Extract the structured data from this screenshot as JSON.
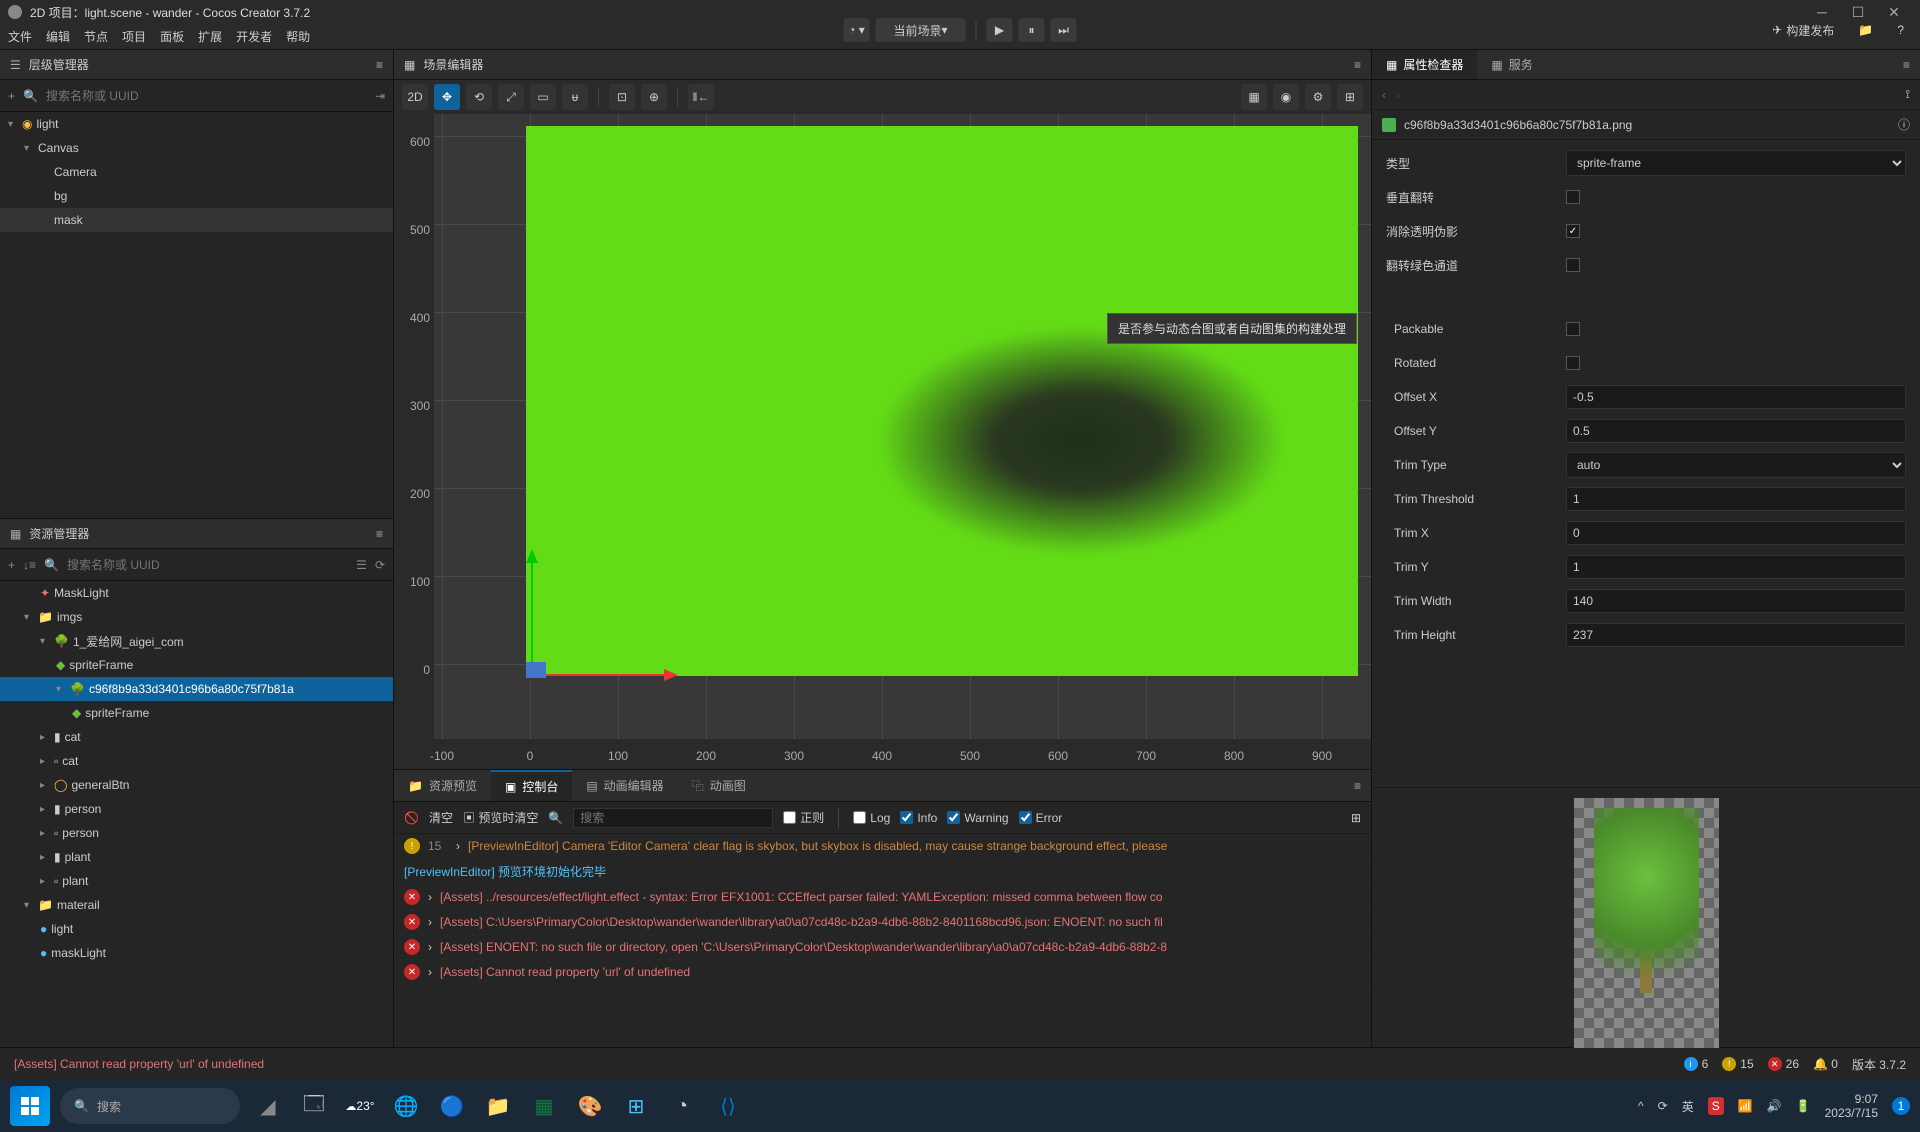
{
  "titlebar": {
    "title": "2D 项目：light.scene - wander - Cocos Creator 3.7.2"
  },
  "menubar": [
    "文件",
    "编辑",
    "节点",
    "项目",
    "面板",
    "扩展",
    "开发者",
    "帮助"
  ],
  "toolbar_center": {
    "scene_label": "当前场景"
  },
  "toolbar_right": {
    "build": "构建发布"
  },
  "hierarchy": {
    "title": "层级管理器",
    "search_placeholder": "搜索名称或 UUID",
    "nodes": [
      "light",
      "Canvas",
      "Camera",
      "bg",
      "mask"
    ]
  },
  "assets": {
    "title": "资源管理器",
    "search_placeholder": "搜索名称或 UUID",
    "items": {
      "masklight": "MaskLight",
      "imgs": "imgs",
      "aigei": "1_爱给网_aigei_com",
      "sf1": "spriteFrame",
      "selected": "c96f8b9a33d3401c96b6a80c75f7b81a",
      "sf2": "spriteFrame",
      "cat1": "cat",
      "cat2": "cat",
      "general": "generalBtn",
      "person1": "person",
      "person2": "person",
      "plant1": "plant",
      "plant2": "plant",
      "material": "materail",
      "light": "light",
      "maskLight": "maskLight"
    }
  },
  "scene": {
    "title": "场景编辑器",
    "mode": "2D",
    "v_ticks": [
      "600",
      "500",
      "400",
      "300",
      "200",
      "100",
      "0"
    ],
    "h_ticks": [
      "-100",
      "0",
      "100",
      "200",
      "300",
      "400",
      "500",
      "600",
      "700",
      "800",
      "900"
    ]
  },
  "tooltip": "是否参与动态合图或者自动图集的构建处理",
  "bottom_tabs": {
    "preview": "资源预览",
    "console": "控制台",
    "anim": "动画编辑器",
    "graph": "动画图"
  },
  "console": {
    "clear": "清空",
    "preview_clear": "预览时清空",
    "search_placeholder": "搜索",
    "regex": "正则",
    "log": "Log",
    "info": "Info",
    "warning": "Warning",
    "error": "Error",
    "rows": [
      {
        "type": "warn",
        "count": "15",
        "msg": "[PreviewInEditor] Camera 'Editor Camera' clear flag is skybox, but skybox is disabled, may cause strange background effect, please"
      },
      {
        "type": "info",
        "msg": "[PreviewInEditor] 预览环境初始化完毕"
      },
      {
        "type": "err",
        "msg": "[Assets] ../resources/effect/light.effect - syntax: Error EFX1001: CCEffect parser failed: YAMLException: missed comma between flow co"
      },
      {
        "type": "err",
        "msg": "[Assets] C:\\Users\\PrimaryColor\\Desktop\\wander\\wander\\library\\a0\\a07cd48c-b2a9-4db6-88b2-8401168bcd96.json: ENOENT: no such fil"
      },
      {
        "type": "err",
        "msg": "[Assets] ENOENT: no such file or directory, open 'C:\\Users\\PrimaryColor\\Desktop\\wander\\wander\\library\\a0\\a07cd48c-b2a9-4db6-88b2-8"
      },
      {
        "type": "err",
        "msg": "[Assets] Cannot read property 'url' of undefined"
      }
    ]
  },
  "inspector": {
    "tab1": "属性检查器",
    "tab2": "服务",
    "asset_name": "c96f8b9a33d3401c96b6a80c75f7b81a.png",
    "props": {
      "type_label": "类型",
      "type_val": "sprite-frame",
      "flip_v": "垂直翻转",
      "fix_alpha": "消除透明伪影",
      "flip_g": "翻转绿色通道",
      "packable": "Packable",
      "rotated": "Rotated",
      "offsetx": "Offset X",
      "offsetx_val": "-0.5",
      "offsety": "Offset Y",
      "offsety_val": "0.5",
      "trimtype": "Trim Type",
      "trimtype_val": "auto",
      "trimthresh": "Trim Threshold",
      "trimthresh_val": "1",
      "trimx": "Trim X",
      "trimx_val": "0",
      "trimy": "Trim Y",
      "trimy_val": "1",
      "trimw": "Trim Width",
      "trimw_val": "140",
      "trimh": "Trim Height",
      "trimh_val": "237"
    }
  },
  "statusbar": {
    "msg": "[Assets] Cannot read property 'url' of undefined",
    "info": "6",
    "warn": "15",
    "err": "26",
    "notif": "0",
    "version": "版本 3.7.2"
  },
  "taskbar": {
    "search": "搜索",
    "weather": "23°",
    "time": "9:07",
    "date": "2023/7/15",
    "ime": "英"
  }
}
